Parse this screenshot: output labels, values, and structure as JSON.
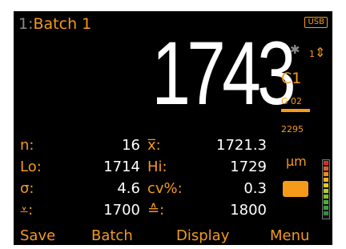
{
  "header": {
    "batch_index": "1:",
    "batch_name": "Batch 1",
    "usb_label": "USB"
  },
  "reading": {
    "value": "1743"
  },
  "status": {
    "bluetooth_icon": "bluetooth-icon",
    "calibration_count": "1",
    "calibration_icon": "up-down-arrow-icon"
  },
  "probe": {
    "calibration": "C1",
    "gauge": "G 02",
    "gauge_value": "2295"
  },
  "stats": {
    "n_label": "n:",
    "n_value": "16",
    "mean_label": "x̅:",
    "mean_value": "1721.3",
    "lo_label": "Lo:",
    "lo_value": "1714",
    "hi_label": "Hi:",
    "hi_value": "1729",
    "sigma_label": "σ:",
    "sigma_value": "4.6",
    "cv_label": "cv%:",
    "cv_value": "0.3",
    "lower_limit_label": "⩡:",
    "lower_limit_value": "1700",
    "upper_limit_label": "≙:",
    "upper_limit_value": "1800"
  },
  "units": {
    "label": "μm"
  },
  "level_bar": {
    "colors": [
      "#d93020",
      "#e45a1f",
      "#f08c1c",
      "#f5b51a",
      "#e3cd18",
      "#b8cc1f",
      "#7ebf2d",
      "#4fae34",
      "#3a9f3a",
      "#2f9038"
    ]
  },
  "softkeys": {
    "save": "Save",
    "batch": "Batch",
    "display": "Display",
    "menu": "Menu"
  }
}
